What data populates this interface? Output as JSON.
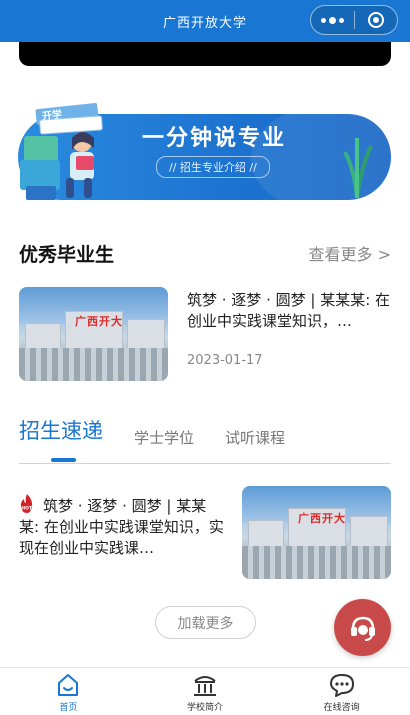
{
  "header": {
    "title": "广西开放大学",
    "more_icon": "more-dots-icon",
    "close_icon": "target-icon"
  },
  "banner": {
    "title": "一分钟说专业",
    "subtitle": "// 招生专业介绍 //",
    "book_label": "开学"
  },
  "graduates": {
    "title": "优秀毕业生",
    "more_label": "查看更多 >",
    "items": [
      {
        "title": "筑梦 · 逐梦 · 圆梦 | 某某某: 在创业中实践课堂知识，…",
        "date": "2023-01-17",
        "image_sign": "广西开大"
      }
    ]
  },
  "tabs": {
    "items": [
      "招生速递",
      "学士学位",
      "试听课程"
    ],
    "active": 0
  },
  "news": {
    "items": [
      {
        "badge": "HOT",
        "title": "筑梦 · 逐梦 · 圆梦 | 某某某: 在创业中实践课堂知识，实现在创业中实践课…",
        "image_sign": "广西开大"
      }
    ],
    "load_more_label": "加载更多"
  },
  "fab": {
    "icon": "customer-service-icon"
  },
  "bottom_nav": {
    "items": [
      {
        "label": "首页",
        "icon": "home-icon",
        "active": true
      },
      {
        "label": "学校简介",
        "icon": "school-icon",
        "active": false
      },
      {
        "label": "在线咨询",
        "icon": "chat-icon",
        "active": false
      }
    ]
  },
  "colors": {
    "primary": "#1976d2",
    "fab": "#c94a4a",
    "muted": "#888888"
  }
}
